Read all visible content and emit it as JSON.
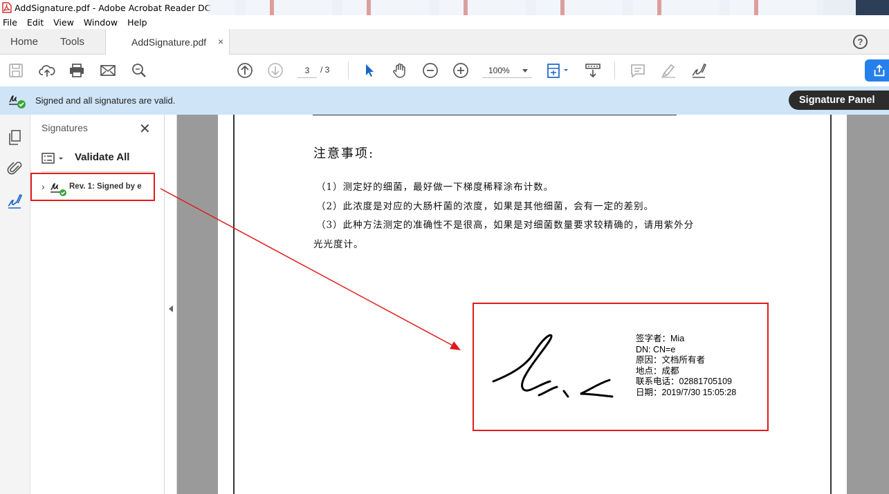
{
  "window": {
    "title": "AddSignature.pdf - Adobe Acrobat Reader DC"
  },
  "menu": [
    "File",
    "Edit",
    "View",
    "Window",
    "Help"
  ],
  "tabs": {
    "home": "Home",
    "tools": "Tools",
    "document": "AddSignature.pdf",
    "close": "×"
  },
  "toolbar": {
    "current_page": "3",
    "total_pages": "/ 3",
    "zoom": "100%",
    "icons": [
      "save-icon",
      "upload-icon",
      "print-icon",
      "email-icon",
      "search-zoom-icon",
      "page-up-icon",
      "page-down-icon",
      "select-arrow-icon",
      "hand-icon",
      "zoom-out-icon",
      "zoom-in-icon",
      "fit-page-icon",
      "scroll-mode-icon",
      "comment-icon",
      "highlight-icon",
      "sign-icon",
      "share-icon"
    ]
  },
  "signature_bar": {
    "status": "Signed and all signatures are valid.",
    "panel_button": "Signature Panel"
  },
  "signatures_panel": {
    "title": "Signatures",
    "close": "✕",
    "validate_all": "Validate All",
    "item_label": "Rev. 1: Signed by e"
  },
  "document": {
    "notes_title": "注意事项:",
    "notes": [
      "（1）测定好的细菌，最好做一下梯度稀释涂布计数。",
      "（2）此浓度是对应的大肠杆菌的浓度，如果是其他细菌，会有一定的差别。",
      "（3）此种方法测定的准确性不是很高，如果是对细菌数量要求较精确的，请用紫外分",
      "光光度计。"
    ],
    "signature_info": [
      "签字者：Mia",
      "DN: CN=e",
      "原因：文档所有者",
      "地点：成都",
      "联系电话：02881705109",
      "日期：2019/7/30 15:05:28"
    ]
  },
  "colors": {
    "accent": "#2680eb",
    "signature_bar_bg": "#cfe4f7",
    "annotation_red": "#e01b1b",
    "valid_green": "#3aa53a"
  }
}
